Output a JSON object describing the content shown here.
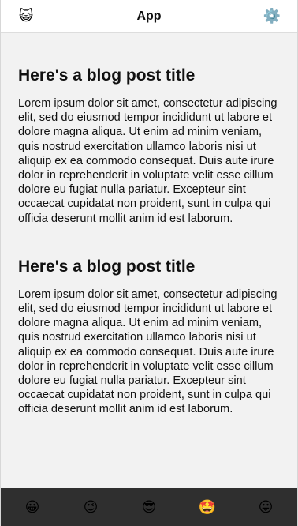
{
  "header": {
    "title": "App",
    "left_icon": "😺",
    "right_icon": "⚙️"
  },
  "posts": [
    {
      "title": "Here's a blog post title",
      "body": "Lorem ipsum dolor sit amet, consectetur adipiscing elit, sed do eiusmod tempor incididunt ut labore et dolore magna aliqua. Ut enim ad minim veniam, quis nostrud exercitation ullamco laboris nisi ut aliquip ex ea commodo consequat. Duis aute irure dolor in reprehenderit in voluptate velit esse cillum dolore eu fugiat nulla pariatur. Excepteur sint occaecat cupidatat non proident, sunt in culpa qui officia deserunt mollit anim id est laborum."
    },
    {
      "title": "Here's a blog post title",
      "body": "Lorem ipsum dolor sit amet, consectetur adipiscing elit, sed do eiusmod tempor incididunt ut labore et dolore magna aliqua. Ut enim ad minim veniam, quis nostrud exercitation ullamco laboris nisi ut aliquip ex ea commodo consequat. Duis aute irure dolor in reprehenderit in voluptate velit esse cillum dolore eu fugiat nulla pariatur. Excepteur sint occaecat cupidatat non proident, sunt in culpa qui officia deserunt mollit anim id est laborum."
    }
  ],
  "tabbar": {
    "tabs": [
      {
        "icon": "😀"
      },
      {
        "icon": "😉"
      },
      {
        "icon": "😎"
      },
      {
        "icon": "🤩"
      },
      {
        "icon": "😛"
      }
    ]
  }
}
